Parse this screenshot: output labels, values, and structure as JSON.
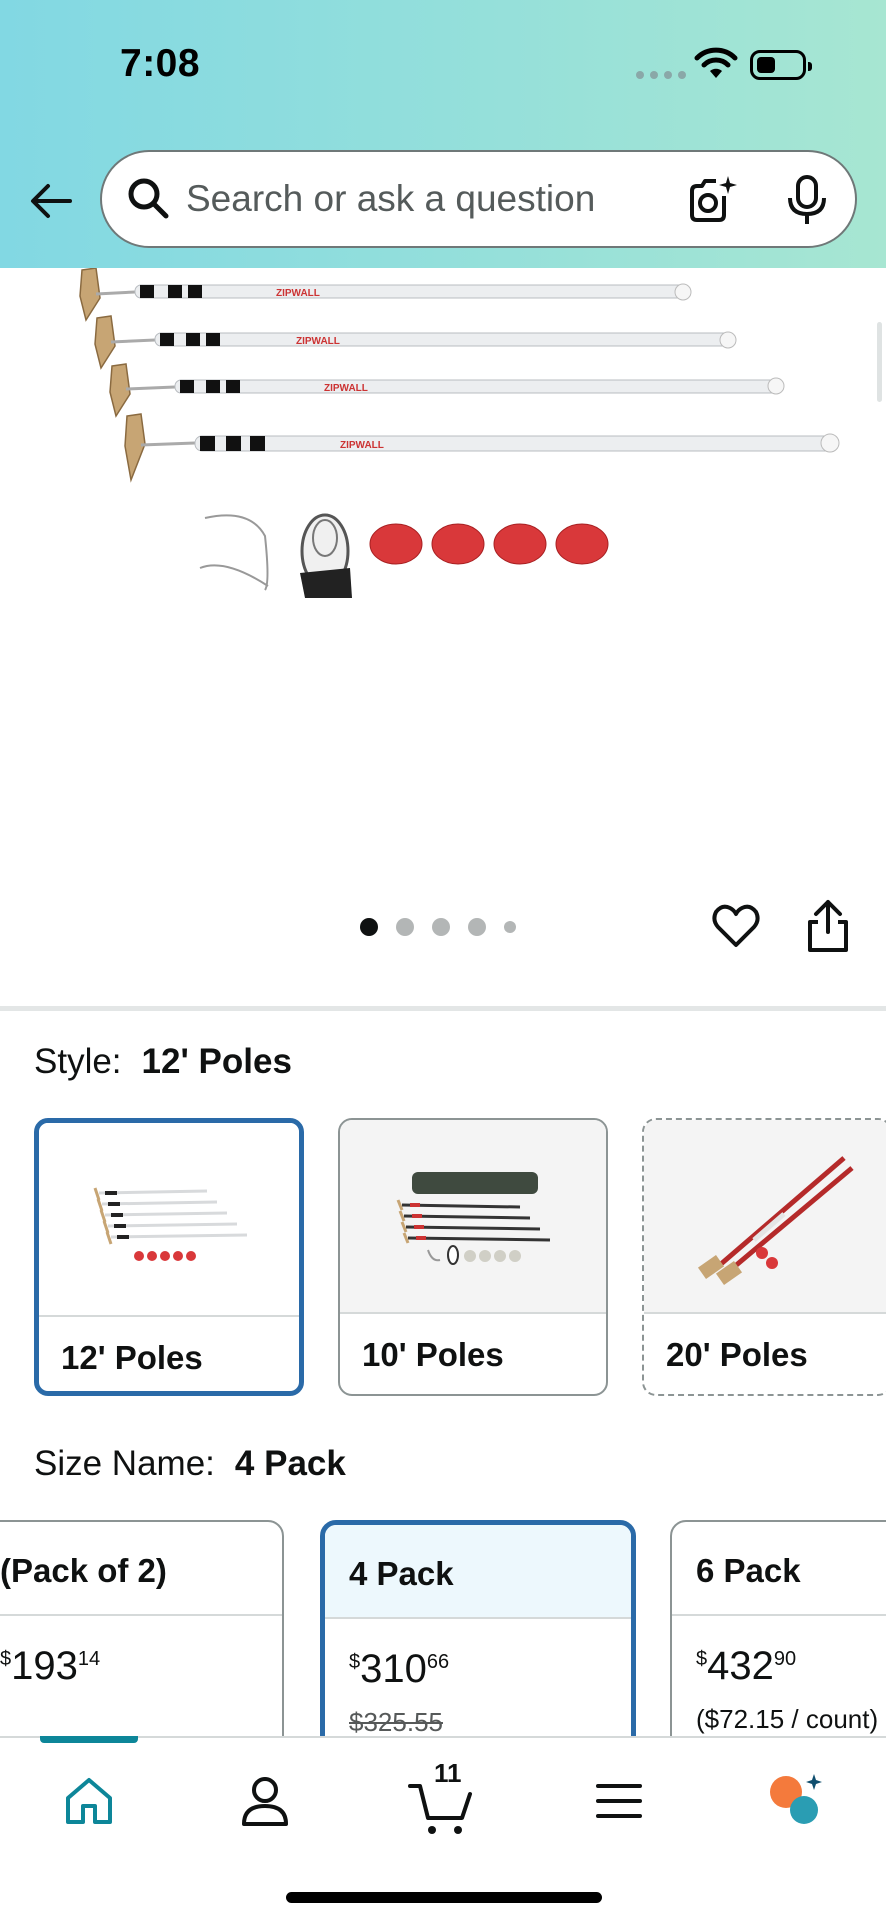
{
  "status_bar": {
    "time": "7:08"
  },
  "search": {
    "placeholder": "Search or ask a question"
  },
  "gallery": {
    "brand_marks": [
      "ZIPWALL",
      "ZIPWALL",
      "ZIPWALL",
      "ZIPWALL"
    ],
    "image_count": 5,
    "active_index": 0
  },
  "style": {
    "label": "Style:",
    "selected": "12' Poles",
    "options": [
      {
        "label": "12' Poles"
      },
      {
        "label": "10' Poles"
      },
      {
        "label": "20' Poles"
      }
    ]
  },
  "size": {
    "label": "Size Name:",
    "selected": "4 Pack",
    "options": [
      {
        "name": "(Pack of 2)",
        "symbol": "$",
        "whole": "193",
        "fraction": "14",
        "sub": ""
      },
      {
        "name": "4 Pack",
        "symbol": "$",
        "whole": "310",
        "fraction": "66",
        "sub": "$325.55"
      },
      {
        "name": "6 Pack",
        "symbol": "$",
        "whole": "432",
        "fraction": "90",
        "sub": "($72.15 / count)"
      }
    ]
  },
  "tabbar": {
    "cart_count": "11"
  },
  "colors": {
    "accent": "#2a6aa8",
    "tab_active": "#0d8699",
    "header_gradient_start": "#82d8e3",
    "header_gradient_end": "#a7e6d2"
  },
  "icons": [
    "back-arrow-icon",
    "search-icon",
    "camera-icon",
    "mic-icon",
    "heart-icon",
    "share-icon",
    "home-icon",
    "account-icon",
    "cart-icon",
    "menu-icon",
    "rufus-icon"
  ]
}
